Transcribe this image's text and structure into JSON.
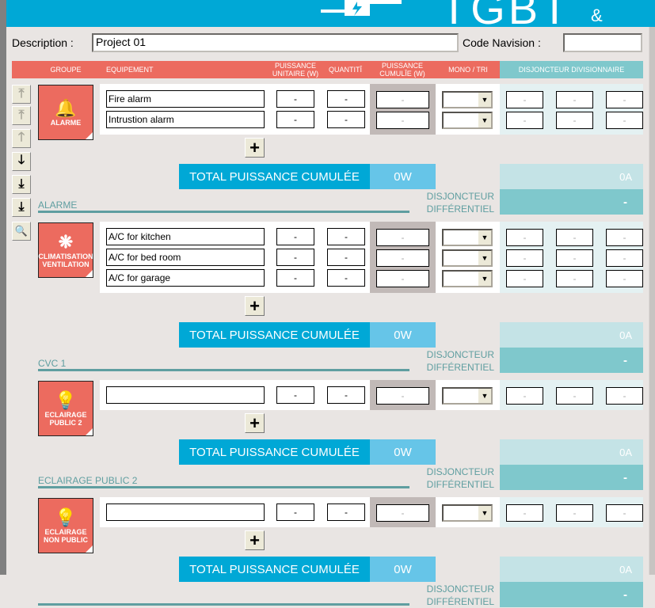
{
  "header": {
    "title": "TGBT",
    "subtitle": "& BESO",
    "logo": "plug-lightning-icon",
    "bg": "#00a8d6"
  },
  "description": {
    "label": "Description :",
    "value": "Project 01"
  },
  "code_navision": {
    "label": "Code Navision :",
    "value": ""
  },
  "columns": {
    "groupe": "GROUPE",
    "equipement": "EQUIPEMENT",
    "puissance_unitaire": [
      "PUISSANCE",
      "UNITAIRE (W)"
    ],
    "quantite": "QUANTITÎ",
    "puissance_cumulee": [
      "PUISSANCE",
      "CUMULÎE (W)"
    ],
    "mono_tri": "MONO / TRI",
    "disjoncteur_divisionnaire": "DISJONCTEUR DIVISIONNAIRE"
  },
  "nav_buttons": [
    {
      "name": "move-top-icon",
      "glyph": "⤒",
      "enabled": false
    },
    {
      "name": "move-top-icon",
      "glyph": "⤒",
      "enabled": false
    },
    {
      "name": "move-up-icon",
      "glyph": "🡑",
      "enabled": false
    },
    {
      "name": "move-down-icon",
      "glyph": "🡓",
      "enabled": true
    },
    {
      "name": "move-down-bar-icon",
      "glyph": "⤓",
      "enabled": true
    },
    {
      "name": "move-bottom-icon",
      "glyph": "⤓",
      "enabled": true
    },
    {
      "name": "search-icon",
      "glyph": "🔍",
      "enabled": true
    }
  ],
  "total_label": "TOTAL PUISSANCE CUMULÉE",
  "disj_label": [
    "DISJONCTEUR",
    "DIFFÉRENTIEL"
  ],
  "groups": [
    {
      "tile": [
        "ALARME"
      ],
      "icon": "alarm-bell-icon",
      "glyph": "🔔",
      "label": "ALARME",
      "rows": [
        {
          "equip": "Fire alarm",
          "unit": "-",
          "qty": "-",
          "cumul": "-",
          "mono": "",
          "d": [
            "-",
            "-",
            "-"
          ]
        },
        {
          "equip": "Intrustion alarm",
          "unit": "-",
          "qty": "-",
          "cumul": "-",
          "mono": "",
          "d": [
            "-",
            "-",
            "-"
          ]
        }
      ],
      "total": "0W",
      "amps": "0A",
      "diff": "-"
    },
    {
      "tile": [
        "CLIMATISATION",
        "VENTILATION"
      ],
      "icon": "fan-icon",
      "glyph": "❋",
      "label": "CVC 1",
      "rows": [
        {
          "equip": "A/C for kitchen",
          "unit": "-",
          "qty": "-",
          "cumul": "-",
          "mono": "",
          "d": [
            "-",
            "-",
            "-"
          ]
        },
        {
          "equip": "A/C for bed room",
          "unit": "-",
          "qty": "-",
          "cumul": "-",
          "mono": "",
          "d": [
            "-",
            "-",
            "-"
          ]
        },
        {
          "equip": "A/C for garage",
          "unit": "-",
          "qty": "-",
          "cumul": "-",
          "mono": "",
          "d": [
            "-",
            "-",
            "-"
          ]
        }
      ],
      "total": "0W",
      "amps": "0A",
      "diff": "-"
    },
    {
      "tile": [
        "ECLAIRAGE",
        "PUBLIC  2"
      ],
      "icon": "lightbulb-icon",
      "glyph": "💡",
      "label": "ECLAIRAGE PUBLIC 2",
      "rows": [
        {
          "equip": "",
          "unit": "-",
          "qty": "-",
          "cumul": "-",
          "mono": "",
          "d": [
            "-",
            "-",
            "-"
          ]
        }
      ],
      "total": "0W",
      "amps": "0A",
      "diff": "-"
    },
    {
      "tile": [
        "ECLAIRAGE",
        "NON PUBLIC"
      ],
      "icon": "lightbulb-icon",
      "glyph": "💡",
      "label": "",
      "rows": [
        {
          "equip": "",
          "unit": "-",
          "qty": "-",
          "cumul": "-",
          "mono": "",
          "d": [
            "-",
            "-",
            "-"
          ]
        }
      ],
      "total": "0W",
      "amps": "0A",
      "diff": "-"
    }
  ]
}
